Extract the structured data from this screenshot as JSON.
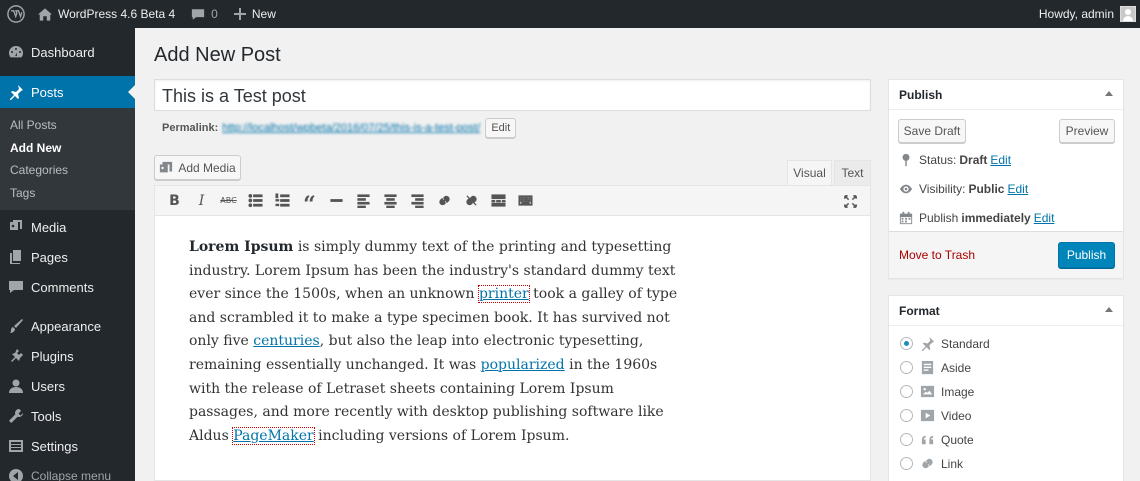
{
  "adminbar": {
    "site_name": "WordPress 4.6 Beta 4",
    "comments_count": "0",
    "new_label": "New",
    "howdy": "Howdy, admin"
  },
  "sidebar": {
    "dashboard": "Dashboard",
    "posts": "Posts",
    "posts_sub": [
      "All Posts",
      "Add New",
      "Categories",
      "Tags"
    ],
    "media": "Media",
    "pages": "Pages",
    "comments": "Comments",
    "appearance": "Appearance",
    "plugins": "Plugins",
    "users": "Users",
    "tools": "Tools",
    "settings": "Settings",
    "collapse": "Collapse menu"
  },
  "main": {
    "page_title": "Add New Post",
    "post_title": "This is a Test post",
    "permalink_label": "Permalink:",
    "permalink_url": "http://localhost/wpbeta/2016/07/25/this-is-a-test-post/",
    "edit_label": "Edit",
    "add_media": "Add Media",
    "tab_visual": "Visual",
    "tab_text": "Text",
    "content": {
      "bold": "Lorem Ipsum",
      "t1": " is simply dummy text of the printing and typesetting industry. Lorem Ipsum has been the industry's standard dummy text ever since the 1500s, when an unknown ",
      "link1": "printer",
      "t2": " took a galley of type and scrambled it to make a type specimen book. It has survived not only five ",
      "link2": "centuries",
      "t3": ", but also the leap into electronic typesetting, remaining essentially unchanged. It was ",
      "link3": "popularized",
      "t4": " in the 1960s with the release of Letraset sheets containing Lorem Ipsum passages, and more recently with desktop publishing software like Aldus ",
      "link4": "PageMaker",
      "t5": " including versions of Lorem Ipsum."
    }
  },
  "publish": {
    "title": "Publish",
    "save_draft": "Save Draft",
    "preview": "Preview",
    "status_label": "Status:",
    "status_value": "Draft",
    "visibility_label": "Visibility:",
    "visibility_value": "Public",
    "publish_label": "Publish",
    "publish_value": "immediately",
    "edit": "Edit",
    "trash": "Move to Trash",
    "publish_button": "Publish"
  },
  "format": {
    "title": "Format",
    "options": [
      "Standard",
      "Aside",
      "Image",
      "Video",
      "Quote",
      "Link"
    ],
    "selected": "Standard"
  },
  "colors": {
    "admin_dark": "#23282d",
    "accent": "#0073aa",
    "publish_button": "#0085ba",
    "trash": "#aa0000"
  }
}
